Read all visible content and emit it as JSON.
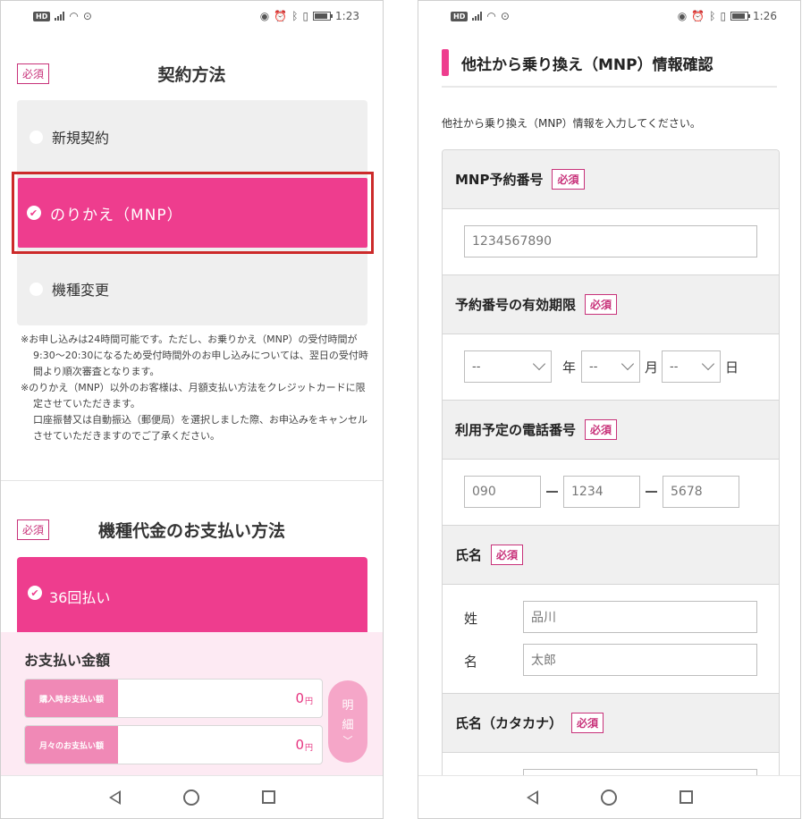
{
  "left": {
    "status": {
      "time": "1:23",
      "hd": "HD"
    },
    "contract": {
      "required": "必須",
      "title": "契約方法",
      "options": [
        "新規契約",
        "のりかえ（MNP）",
        "機種変更"
      ],
      "selected_index": 1,
      "notes": [
        "※お申し込みは24時間可能です。ただし、お乗りかえ（MNP）の受付時間が9:30～20:30になるため受付時間外のお申し込みについては、翌日の受付時間より順次審査となります。",
        "※のりかえ（MNP）以外のお客様は、月額支払い方法をクレジットカードに限定させていただきます。",
        "口座振替又は自動振込（郵便局）を選択しました際、お申込みをキャンセルさせていただきますのでご了承ください。"
      ]
    },
    "payment": {
      "required": "必須",
      "title": "機種代金のお支払い方法",
      "selected_option": "36回払い"
    },
    "amount": {
      "title": "お支払い金額",
      "rows": [
        {
          "label": "購入時お支払い額",
          "value": "0",
          "unit": "円"
        },
        {
          "label": "月々のお支払い額",
          "value": "0",
          "unit": "円"
        }
      ],
      "detail_button": [
        "明",
        "細"
      ]
    }
  },
  "right": {
    "status": {
      "time": "1:26",
      "hd": "HD"
    },
    "title": "他社から乗り換え（MNP）情報確認",
    "intro": "他社から乗り換え（MNP）情報を入力してください。",
    "required": "必須",
    "fields": {
      "mnp_number": {
        "label": "MNP予約番号",
        "value": "1234567890"
      },
      "expiry": {
        "label": "予約番号の有効期限",
        "year": "--",
        "month": "--",
        "day": "--",
        "year_unit": "年",
        "month_unit": "月",
        "day_unit": "日"
      },
      "phone": {
        "label": "利用予定の電話番号",
        "parts": [
          "090",
          "1234",
          "5678"
        ]
      },
      "name": {
        "label": "氏名",
        "last_label": "姓",
        "last_value": "品川",
        "first_label": "名",
        "first_value": "太郎"
      },
      "kana": {
        "label": "氏名（カタカナ）"
      }
    }
  },
  "colors": {
    "accent": "#ee3d8e",
    "highlight": "#cc2a2a",
    "required": "#c8327a"
  }
}
